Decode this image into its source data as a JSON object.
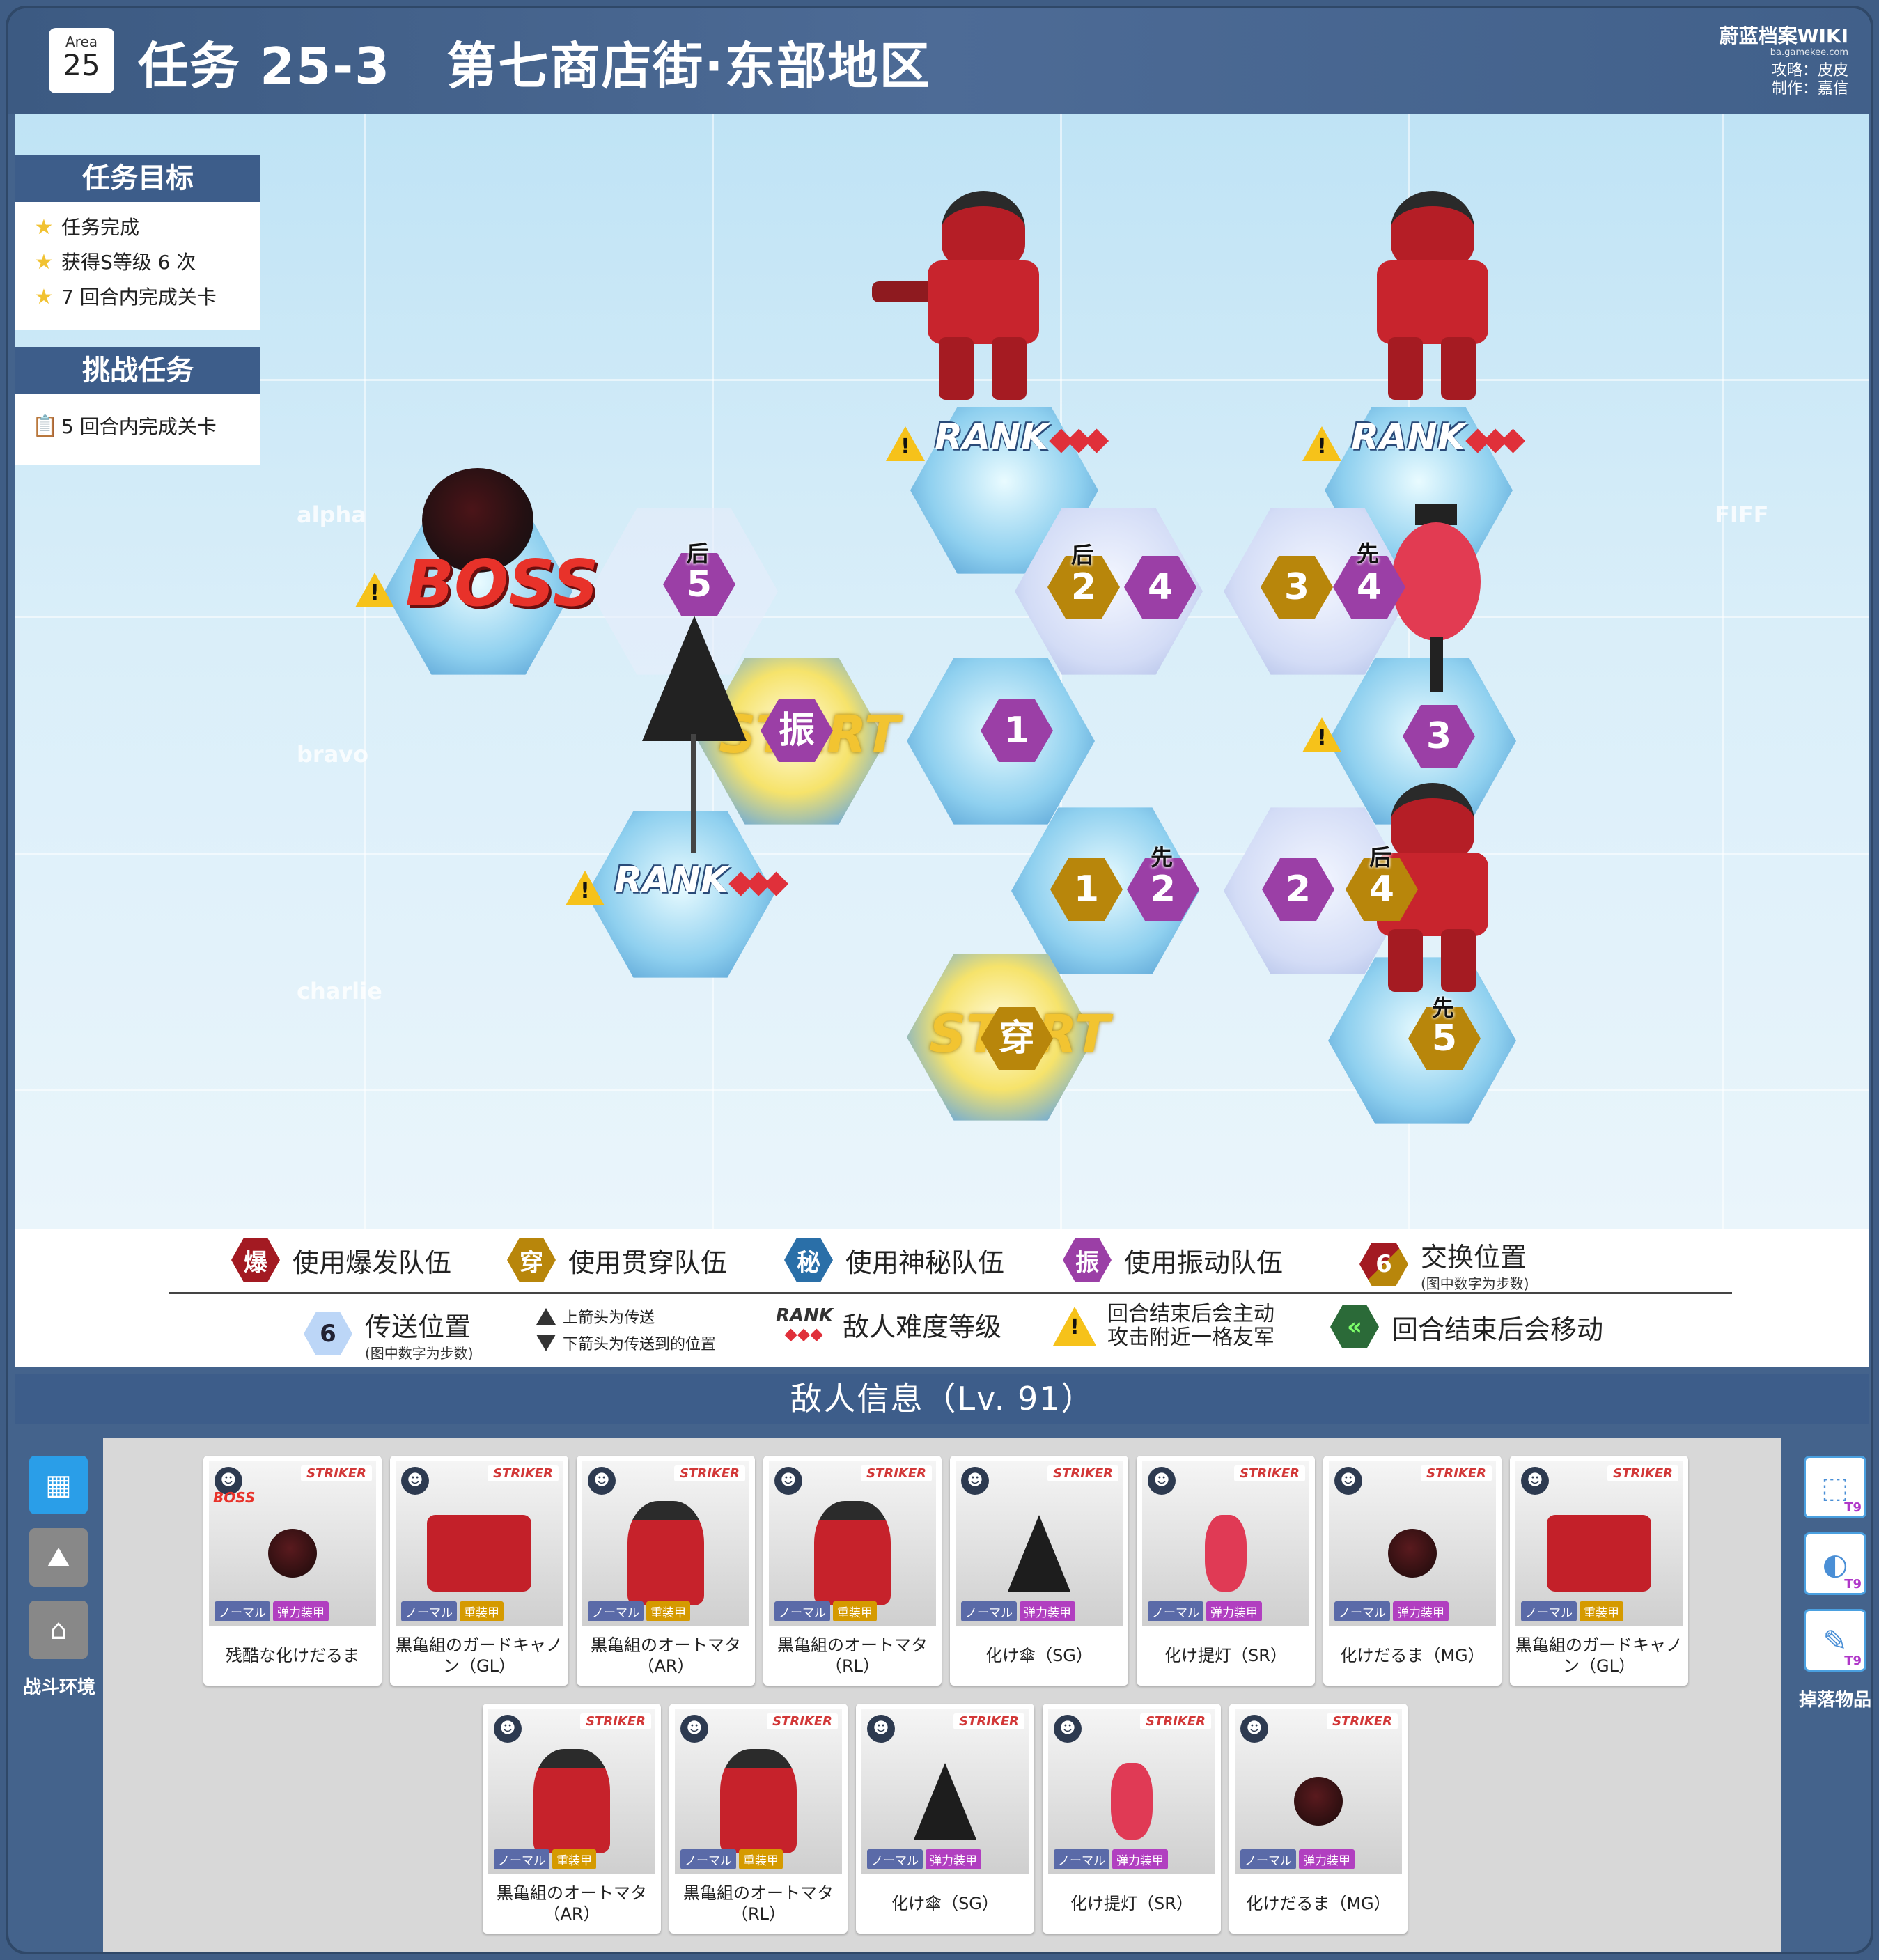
{
  "header": {
    "area_label": "Area",
    "area_number": "25",
    "mission": "任务 25-3",
    "stage_name": "第七商店街·东部地区",
    "wiki_name": "蔚蓝档案WIKI",
    "wiki_domain": "ba.gamekee.com",
    "guide": "攻略：皮皮",
    "producer": "制作：嘉信"
  },
  "objectives": {
    "title": "任务目标",
    "items": [
      "任务完成",
      "获得S等级 6 次",
      "7 回合内完成关卡"
    ]
  },
  "challenge": {
    "title": "挑战任务",
    "items": [
      "5 回合内完成关卡"
    ]
  },
  "map": {
    "grid_labels": [
      "alpha",
      "bravo",
      "charlie",
      "FIFF"
    ],
    "start_text": "START",
    "boss_text": "BOSS",
    "rank_text": "RANK",
    "chevrons": "◆◆◆",
    "markers": [
      {
        "value": "5",
        "tag": "后",
        "color": "purple"
      },
      {
        "value": "2",
        "tag": "后",
        "color": "gold"
      },
      {
        "value": "4",
        "tag": "",
        "color": "purple"
      },
      {
        "value": "3",
        "tag": "",
        "color": "gold"
      },
      {
        "value": "4",
        "tag": "先",
        "color": "purple"
      },
      {
        "value": "振",
        "tag": "",
        "color": "purple"
      },
      {
        "value": "1",
        "tag": "",
        "color": "purple"
      },
      {
        "value": "3",
        "tag": "",
        "color": "purple"
      },
      {
        "value": "1",
        "tag": "",
        "color": "gold"
      },
      {
        "value": "2",
        "tag": "先",
        "color": "purple"
      },
      {
        "value": "2",
        "tag": "",
        "color": "purple"
      },
      {
        "value": "4",
        "tag": "后",
        "color": "gold"
      },
      {
        "value": "穿",
        "tag": "",
        "color": "gold"
      },
      {
        "value": "5",
        "tag": "先",
        "color": "gold"
      }
    ]
  },
  "legend": {
    "row1": [
      {
        "icon": "爆",
        "label": "使用爆发队伍",
        "color": "#a31a22"
      },
      {
        "icon": "穿",
        "label": "使用贯穿队伍",
        "color": "#b8860b"
      },
      {
        "icon": "秘",
        "label": "使用神秘队伍",
        "color": "#2a6fa8"
      },
      {
        "icon": "振",
        "label": "使用振动队伍",
        "color": "#9b3fa6"
      },
      {
        "icon": "6",
        "label": "交换位置",
        "sub": "(图中数字为步数)",
        "color": "#b8860b"
      }
    ],
    "row2": {
      "teleport_icon": "6",
      "teleport": "传送位置",
      "teleport_sub": "(图中数字为步数)",
      "arrow_up": "上箭头为传送",
      "arrow_down": "下箭头为传送到的位置",
      "rank_icon": "RANK",
      "rank_label": "敌人难度等级",
      "attack_line1": "回合结束后会主动",
      "attack_line2": "攻击附近一格友军",
      "move_label": "回合结束后会移动"
    }
  },
  "enemy_section": {
    "title": "敌人信息（Lv. 91）",
    "left_label": "战斗环境",
    "right_label": "掉落物品",
    "drop_tier": "T9",
    "striker": "STRIKER",
    "normal": "ノーマル",
    "boss_mark": "BOSS",
    "cards": [
      {
        "name": "残酷な化けだるま",
        "armor": "弹力装甲",
        "armor_type": "elastic",
        "sprite": "daruma",
        "boss": true
      },
      {
        "name": "黒亀組のガードキャノン（GL）",
        "armor": "重装甲",
        "armor_type": "heavy",
        "sprite": "cannon",
        "boss": false
      },
      {
        "name": "黒亀組のオートマタ（AR）",
        "armor": "重装甲",
        "armor_type": "heavy",
        "sprite": "robot",
        "boss": false
      },
      {
        "name": "黒亀組のオートマタ（RL）",
        "armor": "重装甲",
        "armor_type": "heavy",
        "sprite": "robot",
        "boss": false
      },
      {
        "name": "化け傘（SG）",
        "armor": "弹力装甲",
        "armor_type": "elastic",
        "sprite": "umb",
        "boss": false
      },
      {
        "name": "化け提灯（SR）",
        "armor": "弹力装甲",
        "armor_type": "elastic",
        "sprite": "lantern",
        "boss": false
      },
      {
        "name": "化けだるま（MG）",
        "armor": "弹力装甲",
        "armor_type": "elastic",
        "sprite": "daruma",
        "boss": false
      },
      {
        "name": "黒亀組のガードキャノン（GL）",
        "armor": "重装甲",
        "armor_type": "heavy",
        "sprite": "cannon",
        "boss": false
      },
      {
        "name": "黒亀組のオートマタ（AR）",
        "armor": "重装甲",
        "armor_type": "heavy",
        "sprite": "robot",
        "boss": false
      },
      {
        "name": "黒亀組のオートマタ（RL）",
        "armor": "重装甲",
        "armor_type": "heavy",
        "sprite": "robot",
        "boss": false
      },
      {
        "name": "化け傘（SG）",
        "armor": "弹力装甲",
        "armor_type": "elastic",
        "sprite": "umb",
        "boss": false
      },
      {
        "name": "化け提灯（SR）",
        "armor": "弹力装甲",
        "armor_type": "elastic",
        "sprite": "lantern",
        "boss": false
      },
      {
        "name": "化けだるま（MG）",
        "armor": "弹力装甲",
        "armor_type": "elastic",
        "sprite": "daruma",
        "boss": false
      }
    ]
  }
}
